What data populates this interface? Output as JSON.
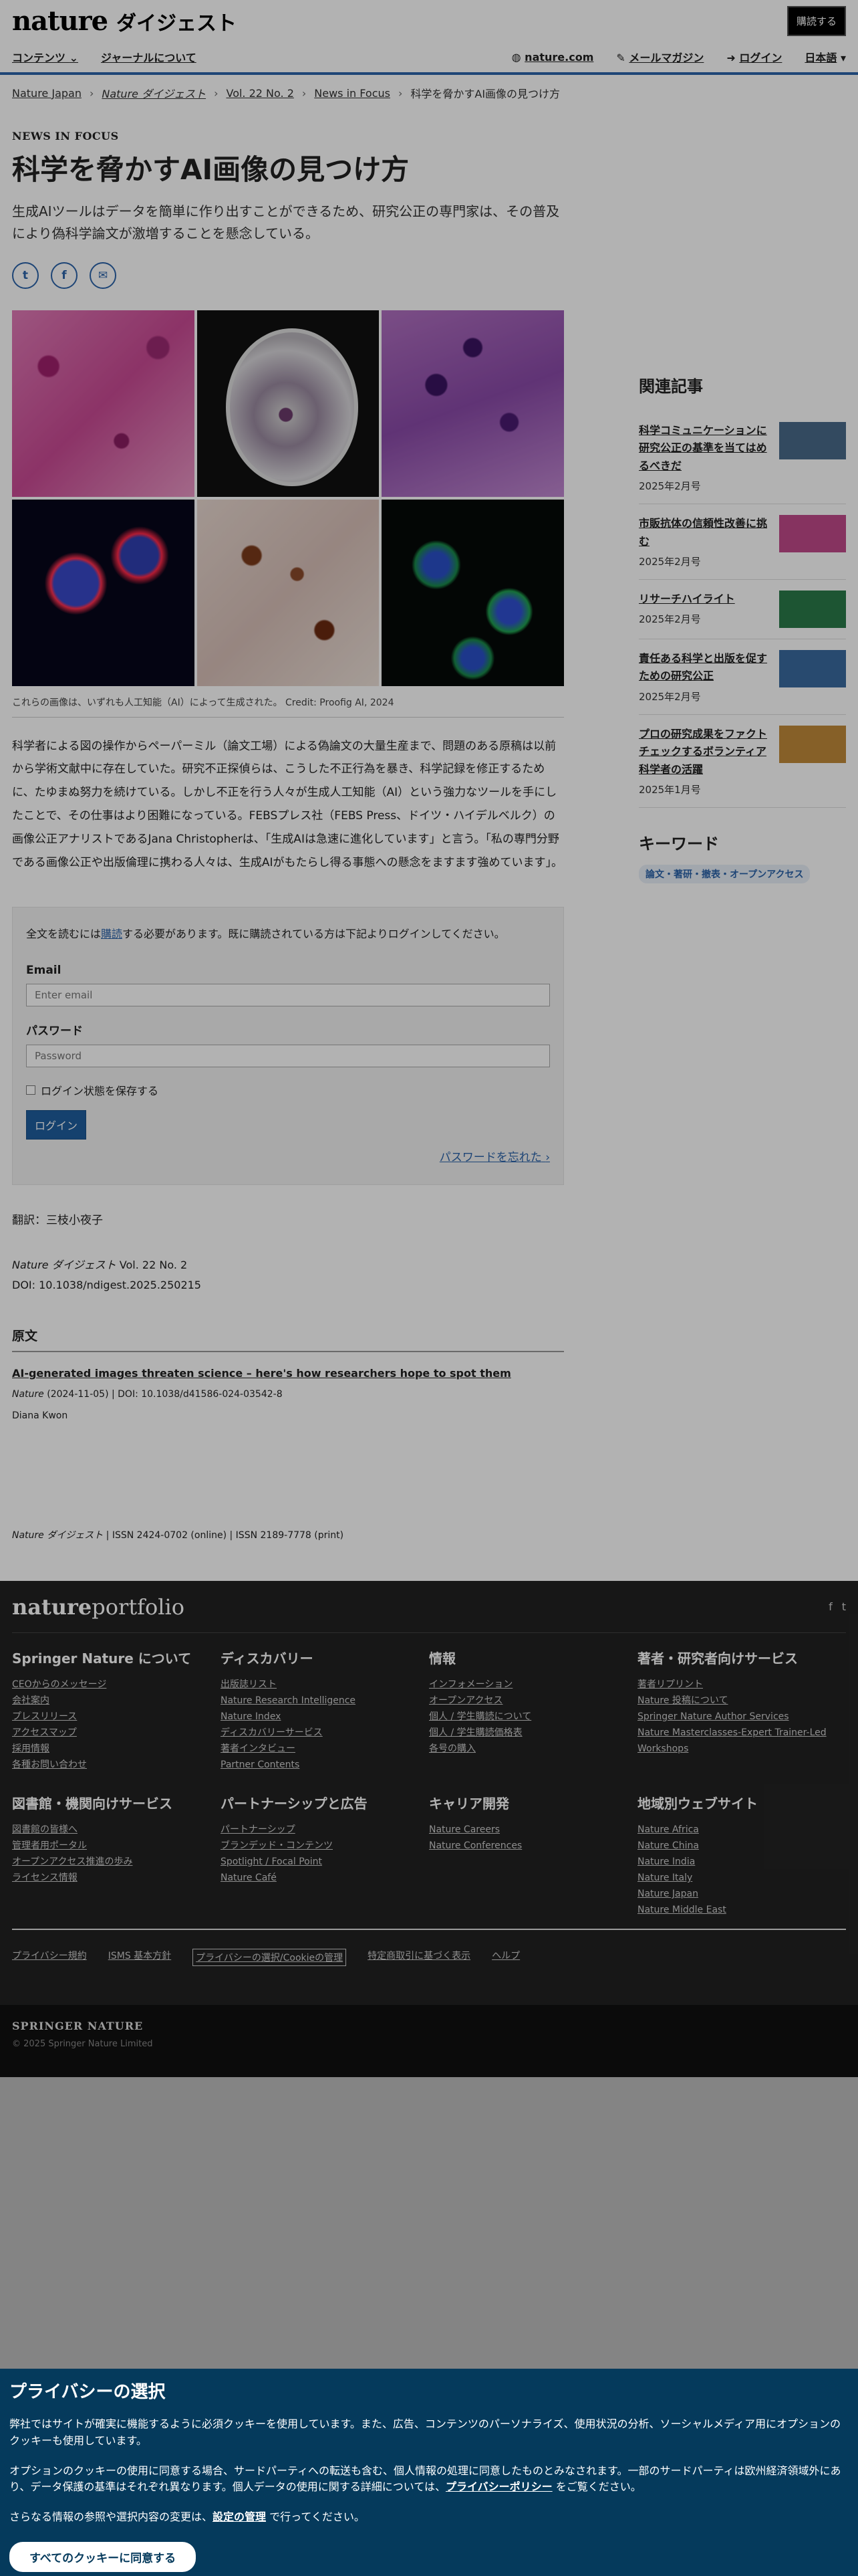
{
  "header": {
    "logo_main": "nature",
    "logo_sub": "ダイジェスト",
    "subscribe": "購読する",
    "nav_left": [
      "コンテンツ",
      "ジャーナルについて"
    ],
    "nature_com": "nature.com",
    "mail_magazine": "メールマガジン",
    "login": "ログイン",
    "lang": "日本語"
  },
  "breadcrumb": [
    "Nature Japan",
    "Nature ダイジェスト",
    "Vol. 22 No. 2",
    "News in Focus",
    "科学を脅かすAI画像の見つけ方"
  ],
  "article": {
    "kicker": "NEWS IN FOCUS",
    "title": "科学を脅かすAI画像の見つけ方",
    "lead": "生成AIツールはデータを簡単に作り出すことができるため、研究公正の専門家は、その普及により偽科学論文が激増することを懸念している。",
    "caption": "これらの画像は、いずれも人工知能（AI）によって生成された。 Credit: Proofig AI, 2024",
    "body": "科学者による図の操作からペーパーミル（論文工場）による偽論文の大量生産まで、問題のある原稿は以前から学術文献中に存在していた。研究不正探偵らは、こうした不正行為を暴き、科学記録を修正するために、たゆまぬ努力を続けている。しかし不正を行う人々が生成人工知能（AI）という強力なツールを手にしたことで、その仕事はより困難になっている。FEBSプレス社（FEBS Press、ドイツ・ハイデルベルク）の画像公正アナリストであるJana Christopherは、「生成AIは急速に進化しています」と言う。「私の専門分野である画像公正や出版倫理に携わる人々は、生成AIがもたらし得る事態への懸念をますます強めています」。"
  },
  "paywall": {
    "msg_before": "全文を読むには",
    "msg_link": "購読",
    "msg_after": "する必要があります。既に購読されている方は下記よりログインしてください。",
    "email_label": "Email",
    "email_placeholder": "Enter email",
    "password_label": "パスワード",
    "password_placeholder": "Password",
    "remember": "ログイン状態を保存する",
    "login_button": "ログイン",
    "forgot": "パスワードを忘れた"
  },
  "meta": {
    "translator": "翻訳：三枝小夜子",
    "journal": "Nature ダイジェスト",
    "volume": " Vol. 22 No. 2",
    "doi": "DOI: 10.1038/ndigest.2025.250215",
    "original_heading": "原文",
    "original_title": "AI-generated images threaten science – here's how researchers hope to spot them",
    "original_journal": "Nature",
    "original_info": " (2024-11-05) | DOI: 10.1038/d41586-024-03542-8",
    "original_author": "Diana Kwon",
    "issn_journal": "Nature ダイジェスト",
    "issn": " | ISSN 2424-0702 (online) | ISSN 2189-7778 (print)"
  },
  "sidebar": {
    "related_heading": "関連記事",
    "related": [
      {
        "title": "科学コミュニケーションに研究公正の基準を当てはめるべきだ",
        "date": "2025年2月号",
        "color": "#4a6a8a"
      },
      {
        "title": "市販抗体の信頼性改善に挑む",
        "date": "2025年2月号",
        "color": "#c04a8a"
      },
      {
        "title": "リサーチハイライト",
        "date": "2025年2月号",
        "color": "#2a7a4a"
      },
      {
        "title": "責任ある科学と出版を促すための研究公正",
        "date": "2025年2月号",
        "color": "#3a6aa0"
      },
      {
        "title": "プロの研究成果をファクトチェックするボランティア科学者の活躍",
        "date": "2025年1月号",
        "color": "#c08a3a"
      }
    ],
    "keyword_heading": "キーワード",
    "keyword": "論文・著研・撤表・オープンアクセス"
  },
  "footer": {
    "logo_a": "nature",
    "logo_b": "portfolio",
    "columns": [
      {
        "h": "Springer Nature について",
        "items": [
          "CEOからのメッセージ",
          "会社案内",
          "プレスリリース",
          "アクセスマップ",
          "採用情報",
          "各種お問い合わせ"
        ]
      },
      {
        "h": "ディスカバリー",
        "items": [
          "出版誌リスト",
          "Nature Research Intelligence",
          "Nature Index",
          "ディスカバリーサービス",
          "著者インタビュー",
          "Partner Contents"
        ]
      },
      {
        "h": "情報",
        "items": [
          "インフォメーション",
          "オープンアクセス",
          "個人 / 学生購読について",
          "個人 / 学生購読価格表",
          "各号の購入"
        ]
      },
      {
        "h": "著者・研究者向けサービス",
        "items": [
          "著者リプリント",
          "Nature 投稿について",
          "Springer Nature Author Services",
          "Nature Masterclasses-Expert Trainer-Led Workshops"
        ]
      },
      {
        "h": "図書館・機関向けサービス",
        "items": [
          "図書館の皆様へ",
          "管理者用ポータル",
          "オープンアクセス推進の歩み",
          "ライセンス情報"
        ]
      },
      {
        "h": "パートナーシップと広告",
        "items": [
          "パートナーシップ",
          "ブランデッド・コンテンツ",
          "Spotlight / Focal Point",
          "Nature Café"
        ]
      },
      {
        "h": "キャリア開発",
        "items": [
          "Nature Careers",
          "Nature Conferences"
        ]
      },
      {
        "h": "地域別ウェブサイト",
        "items": [
          "Nature Africa",
          "Nature China",
          "Nature India",
          "Nature Italy",
          "Nature Japan",
          "Nature Middle East"
        ]
      }
    ],
    "bottom_links": [
      "プライバシー規約",
      "ISMS 基本方針",
      "プライバシーの選択/Cookieの管理",
      "特定商取引に基づく表示",
      "ヘルプ"
    ],
    "sn_logo": "SPRINGER NATURE",
    "copyright": "© 2025 Springer Nature Limited"
  },
  "cookie": {
    "title": "プライバシーの選択",
    "p1": "弊社ではサイトが確実に機能するように必須クッキーを使用しています。また、広告、コンテンツのパーソナライズ、使用状況の分析、ソーシャルメディア用にオプションのクッキーも使用しています。",
    "p2a": "オプションのクッキーの使用に同意する場合、サードパーティへの転送も含む、個人情報の処理に同意したものとみなされます。一部のサードパーティは欧州経済領域外にあり、データ保護の基準はそれぞれ異なります。個人データの使用に関する詳細については、",
    "p2link": "プライバシーポリシー",
    "p2b": " をご覧ください。",
    "p3a": "さらなる情報の参照や選択内容の変更は、",
    "p3link": "設定の管理",
    "p3b": " で行ってください。",
    "accept": "すべてのクッキーに同意する"
  }
}
